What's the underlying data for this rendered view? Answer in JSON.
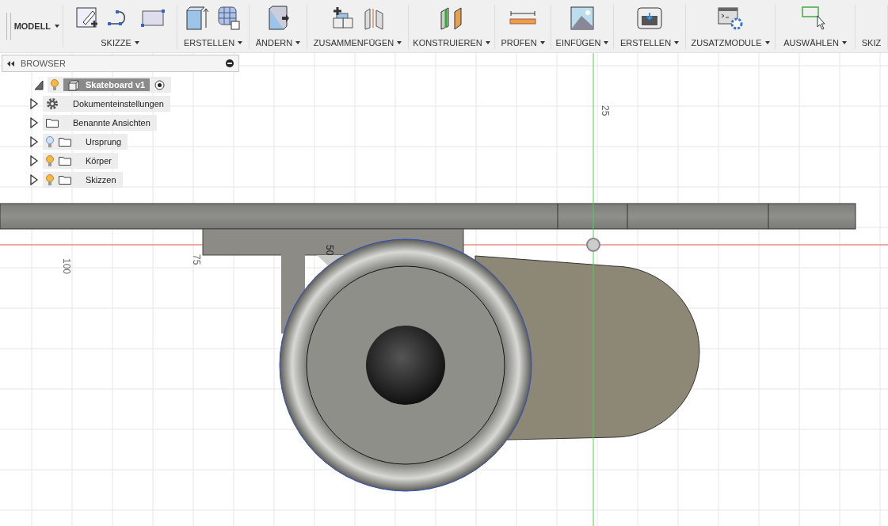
{
  "toolbar": {
    "workspace": {
      "label": "MODELL"
    },
    "groups": [
      {
        "label": "SKIZZE"
      },
      {
        "label": "ERSTELLEN"
      },
      {
        "label": "ÄNDERN"
      },
      {
        "label": "ZUSAMMENFÜGEN"
      },
      {
        "label": "KONSTRUIEREN"
      },
      {
        "label": "PRÜFEN"
      },
      {
        "label": "EINFÜGEN"
      },
      {
        "label": "ERSTELLEN"
      },
      {
        "label": "ZUSATZMODULE"
      },
      {
        "label": "AUSWÄHLEN"
      },
      {
        "label": "SKIZ"
      }
    ]
  },
  "browser": {
    "title": "BROWSER",
    "tree": {
      "label": "Skateboard v1",
      "expanded": true,
      "visible": true,
      "active": true,
      "children": [
        {
          "label": "Dokumenteinstellungen",
          "kind": "settings",
          "expanded": false
        },
        {
          "label": "Benannte Ansichten",
          "kind": "folder",
          "expanded": false
        },
        {
          "label": "Ursprung",
          "kind": "folder",
          "expanded": false,
          "visible": false
        },
        {
          "label": "Körper",
          "kind": "folder",
          "expanded": false,
          "visible": true
        },
        {
          "label": "Skizzen",
          "kind": "folder",
          "expanded": false,
          "visible": true
        }
      ]
    }
  },
  "viewport": {
    "ruler_labels": [
      "25",
      "100",
      "75",
      "50"
    ]
  }
}
